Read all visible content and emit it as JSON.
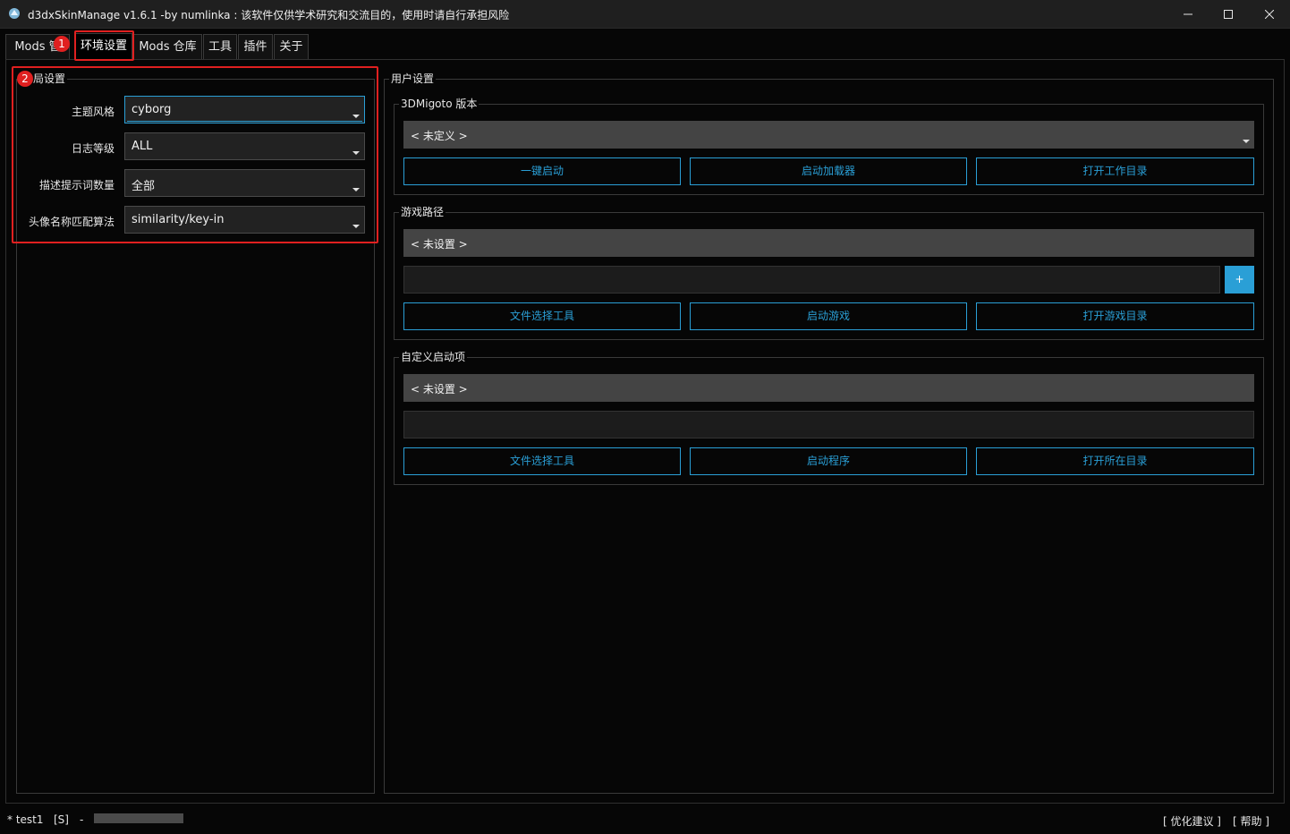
{
  "window": {
    "title": "d3dxSkinManage v1.6.1 -by numlinka : 该软件仅供学术研究和交流目的，使用时请自行承担风险"
  },
  "tabs": [
    "Mods 管",
    "环境设置",
    "Mods 仓库",
    "工具",
    "插件",
    "关于"
  ],
  "markers": [
    "1",
    "2"
  ],
  "global_settings": {
    "title": "局设置",
    "rows": [
      {
        "label": "主题风格",
        "value": "cyborg"
      },
      {
        "label": "日志等级",
        "value": "ALL"
      },
      {
        "label": "描述提示词数量",
        "value": "全部"
      },
      {
        "label": "头像名称匹配算法",
        "value": "similarity/key-in"
      }
    ]
  },
  "user_settings": {
    "title": "用户设置",
    "migoto": {
      "title": "3DMigoto 版本",
      "selected": "< 未定义 >",
      "buttons": [
        "一键启动",
        "启动加载器",
        "打开工作目录"
      ]
    },
    "game_path": {
      "title": "游戏路径",
      "value": "< 未设置 >",
      "input_value": "",
      "plus_label": "+",
      "buttons": [
        "文件选择工具",
        "启动游戏",
        "打开游戏目录"
      ]
    },
    "custom_launch": {
      "title": "自定义启动项",
      "value": "< 未设置 >",
      "input_value": "",
      "buttons": [
        "文件选择工具",
        "启动程序",
        "打开所在目录"
      ]
    }
  },
  "statusbar": {
    "user": "* test1",
    "tag": "[S]",
    "dash": "-",
    "progress": 0,
    "suggest": "[ 优化建议 ]",
    "help": "[ 帮助 ]"
  },
  "colors": {
    "accent": "#2a9fd6",
    "marker": "#e02020",
    "background": "#060606"
  },
  "icons": [
    "app-logo-icon",
    "minimize-icon",
    "maximize-icon",
    "close-icon",
    "dropdown-arrow-icon"
  ]
}
